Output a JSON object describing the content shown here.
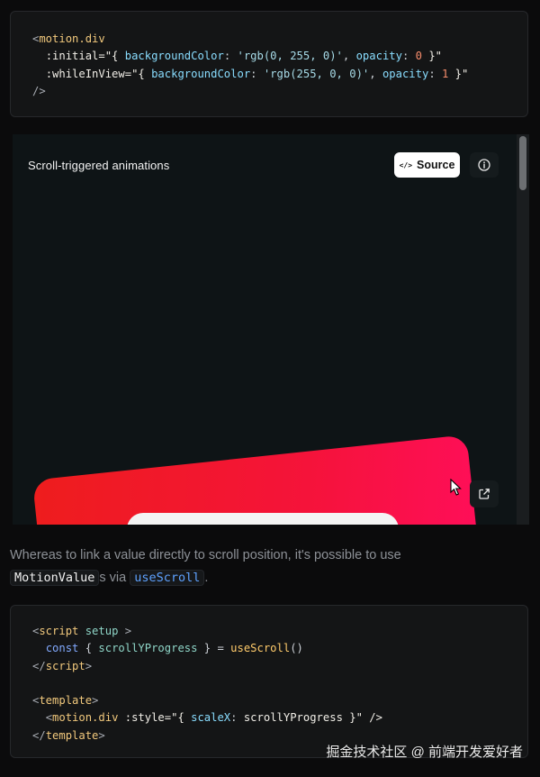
{
  "code_block_1": {
    "lines": [
      [
        "<",
        "motion.div"
      ],
      [
        ":initial=\"{ ",
        "backgroundColor",
        ": ",
        "'rgb(0, 255, 0)'",
        ", ",
        "opacity",
        ": ",
        "0",
        " }\""
      ],
      [
        ":whileInView=\"{ ",
        "backgroundColor",
        ": ",
        "'rgb(255, 0, 0)'",
        ", ",
        "opacity",
        ": ",
        "1",
        " }\""
      ],
      [
        "/>"
      ]
    ]
  },
  "demo": {
    "title": "Scroll-triggered animations",
    "source_button": {
      "icon": "code-icon",
      "label": "Source"
    },
    "info_button": {
      "icon": "info-icon"
    },
    "external_link_button": {
      "icon": "external-link-icon"
    }
  },
  "prose": {
    "text_before": "Whereas to link a value directly to scroll position, it's possible to use ",
    "code_motionvalue": "MotionValue",
    "text_middle": "s via ",
    "code_usescroll": "useScroll",
    "text_after": "."
  },
  "code_block_2": {
    "lines": [
      [
        "<",
        "script",
        " ",
        "setup",
        " >"
      ],
      [
        "const",
        " { ",
        "scrollYProgress",
        " } = ",
        "useScroll",
        "()"
      ],
      [
        "</",
        "script",
        ">"
      ],
      [
        ""
      ],
      [
        "<",
        "template",
        ">"
      ],
      [
        "<",
        "motion.div",
        " :style=\"{ ",
        "scaleX",
        ": ",
        "scrollYProgress",
        " }\" />"
      ],
      [
        "</",
        "template",
        ">"
      ]
    ]
  },
  "watermark": "掘金技术社区 @ 前端开发爱好者"
}
